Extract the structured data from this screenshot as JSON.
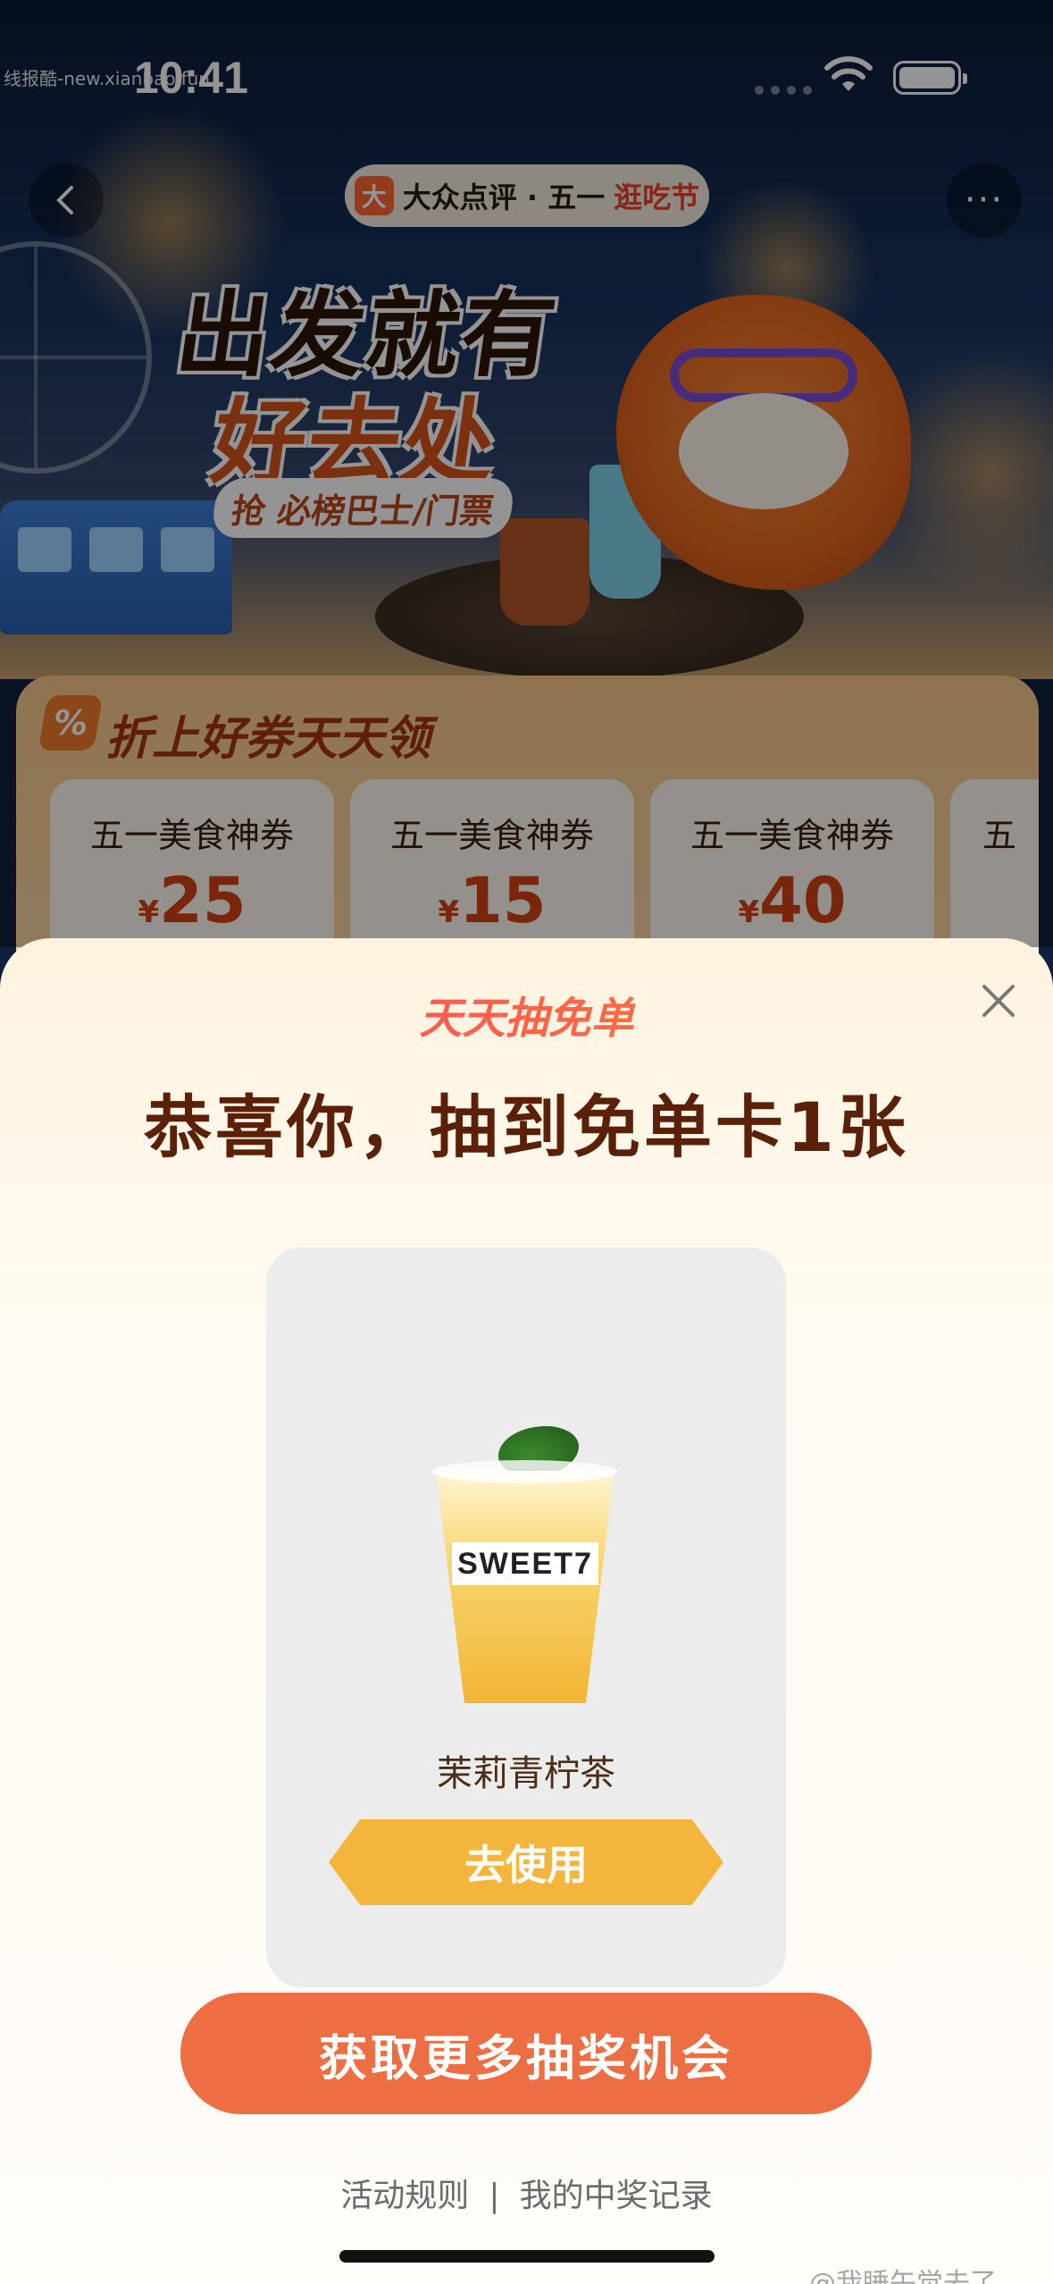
{
  "status_bar": {
    "time": "10:41",
    "watermark": "线报酷-new.xianbao.fun"
  },
  "nav": {
    "brand_logo": "大",
    "brand_name": "大众点评 · 五一",
    "brand_accent": "逛吃节"
  },
  "hero": {
    "headline_1": "出发就有",
    "headline_2": "好去处",
    "subtag": "抢 必榜巴士/门票"
  },
  "coupons": {
    "section_title": "折上好券天天领",
    "badge": "%",
    "items": [
      {
        "title": "五一美食神券",
        "currency": "¥",
        "amount": "25"
      },
      {
        "title": "五一美食神券",
        "currency": "¥",
        "amount": "15"
      },
      {
        "title": "五一美食神券",
        "currency": "¥",
        "amount": "40"
      },
      {
        "title": "五",
        "currency": "",
        "amount": ""
      }
    ]
  },
  "modal": {
    "brand": "天天抽免单",
    "title": "恭喜你，抽到免单卡1张",
    "prize": {
      "cup_label": "SWEET7",
      "name": "茉莉青柠茶",
      "use_label": "去使用"
    },
    "primary_action": "获取更多抽奖机会",
    "rules_link": "活动规则",
    "separator": "|",
    "records_link": "我的中奖记录"
  },
  "watermark_bottom": "@我睡午觉去了",
  "colors": {
    "primary": "#ec6e42",
    "use_button": "#f4b53c",
    "title": "#5a2008"
  }
}
